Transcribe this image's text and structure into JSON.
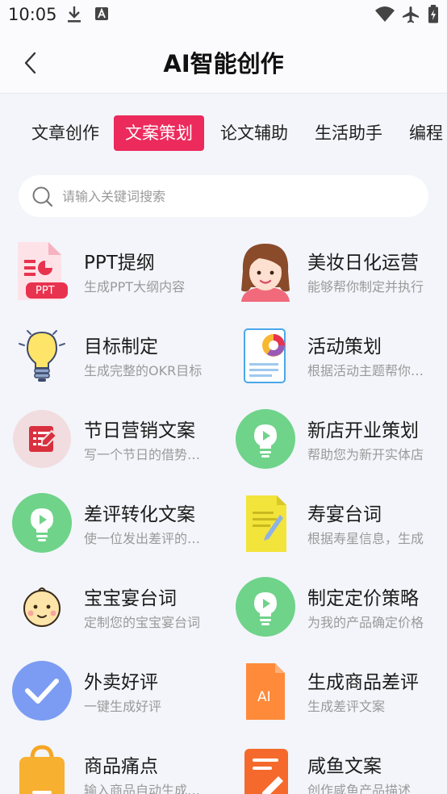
{
  "status_bar": {
    "time": "10:05",
    "left_icons": [
      "download-icon",
      "app-a-icon"
    ],
    "right_icons": [
      "wifi-icon",
      "airplane-icon",
      "battery-icon"
    ]
  },
  "header": {
    "title": "AI智能创作",
    "back_icon": "chevron-left-icon"
  },
  "tabs": [
    {
      "label": "文章创作",
      "active": false
    },
    {
      "label": "文案策划",
      "active": true
    },
    {
      "label": "论文辅助",
      "active": false
    },
    {
      "label": "生活助手",
      "active": false
    },
    {
      "label": "编程",
      "active": false
    }
  ],
  "search": {
    "placeholder": "请输入关键词搜索",
    "value": "",
    "icon": "search-icon"
  },
  "colors": {
    "accent": "#ec2a5c",
    "background": "#f3f5fa",
    "text_secondary": "#9a9a9a"
  },
  "items": [
    {
      "title": "PPT提纲",
      "desc": "生成PPT大纲内容",
      "icon": "ppt-file-icon",
      "badge": "PPT"
    },
    {
      "title": "美妆日化运营",
      "desc": "能够帮你制定并执行",
      "icon": "woman-avatar-icon"
    },
    {
      "title": "目标制定",
      "desc": "生成完整的OKR目标",
      "icon": "lightbulb-icon"
    },
    {
      "title": "活动策划",
      "desc": "根据活动主题帮你策划",
      "icon": "report-chart-icon"
    },
    {
      "title": "节日营销文案",
      "desc": "写一个节日的借势文案",
      "icon": "edit-document-icon"
    },
    {
      "title": "新店开业策划",
      "desc": "帮助您为新开实体店",
      "icon": "bulb-play-icon"
    },
    {
      "title": "差评转化文案",
      "desc": "使一位发出差评的顾客",
      "icon": "bulb-play-icon"
    },
    {
      "title": "寿宴台词",
      "desc": "根据寿星信息，生成",
      "icon": "yellow-note-icon"
    },
    {
      "title": "宝宝宴台词",
      "desc": "定制您的宝宝宴台词",
      "icon": "baby-face-icon"
    },
    {
      "title": "制定定价策略",
      "desc": "为我的产品确定价格",
      "icon": "bulb-play-icon"
    },
    {
      "title": "外卖好评",
      "desc": "一键生成好评",
      "icon": "checkmark-icon"
    },
    {
      "title": "生成商品差评",
      "desc": "生成差评文案",
      "icon": "ai-file-icon",
      "badge": "AI"
    },
    {
      "title": "商品痛点",
      "desc": "输入商品自动生成痛点",
      "icon": "shopping-bag-icon"
    },
    {
      "title": "咸鱼文案",
      "desc": "创作咸鱼产品描述",
      "icon": "orange-edit-icon"
    }
  ]
}
